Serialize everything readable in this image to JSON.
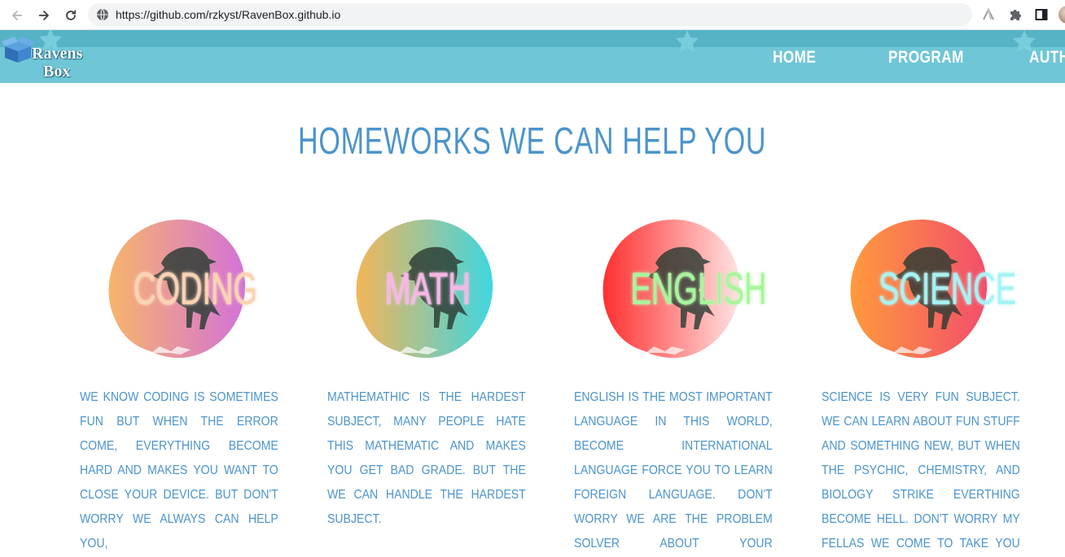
{
  "browser": {
    "url": "https://github.com/rzkyst/RavenBox.github.io"
  },
  "site": {
    "logo_line1": "Ravens",
    "logo_line2": "Box",
    "nav": [
      {
        "label": "HOME"
      },
      {
        "label": "PROGRAM"
      },
      {
        "label": "AUTH"
      }
    ]
  },
  "main": {
    "title": "HOMEWORKS WE CAN HELP YOU",
    "subjects": [
      {
        "label": "CODING",
        "label_color": "#fbd3b3",
        "colors": [
          "#f7b56b",
          "#d372d8"
        ],
        "description": "We know coding is sometimes fun but when the error come, everything become hard and makes you want to close your device. but don't worry we always can help you,"
      },
      {
        "label": "MATH",
        "label_color": "#f7b6e6",
        "colors": [
          "#f3b558",
          "#3fd6e0"
        ],
        "description": "Mathemathic is the hardest subject, many people hate this mathematic and makes you get bad grade. But the we can handle the hardest subject."
      },
      {
        "label": "ENGLISH",
        "label_color": "#a8f59b",
        "colors": [
          "#ff2f2f",
          "#ffe3e3"
        ],
        "description": "English is the most important language in this world, become international language force you to learn foreign language. don't worry we are the problem solver about your homework."
      },
      {
        "label": "SCIENCE",
        "label_color": "#a6f3f4",
        "colors": [
          "#ff9a3d",
          "#f24e6b"
        ],
        "description": "Science is very fun subject. we can learn about fun stuff and something new, but when the psychic, chemistry, and biology strike everthing become hell. Don't worry my fellas we come to take you from hell to heaven."
      }
    ]
  }
}
